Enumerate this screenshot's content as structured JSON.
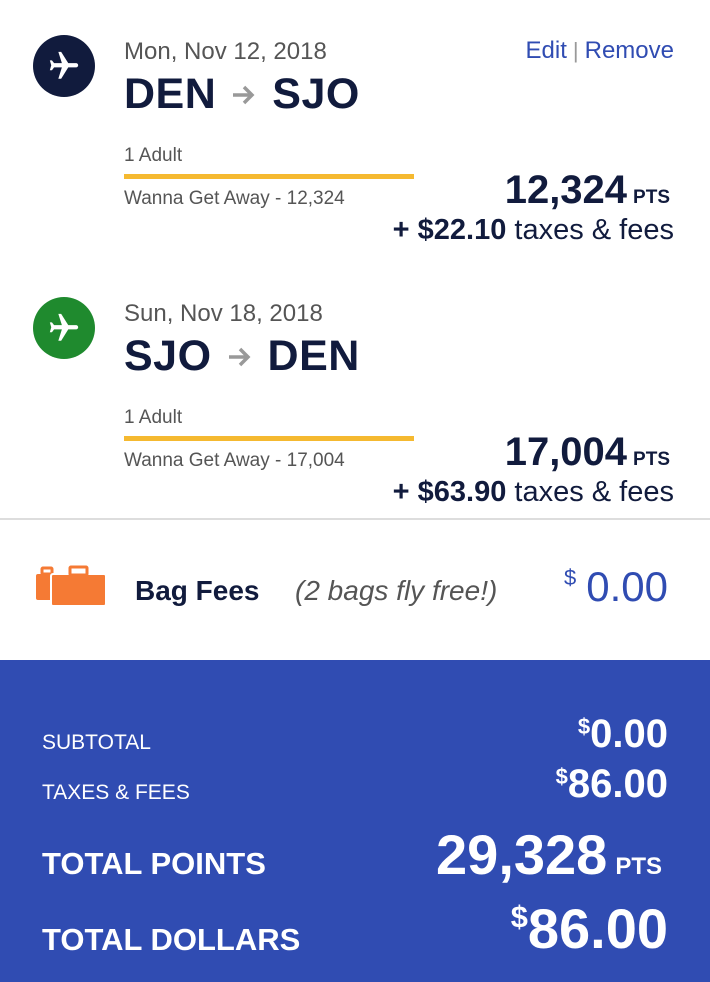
{
  "colors": {
    "navy": "#111b3d",
    "green": "#1f8a2e",
    "blue": "#304cb2",
    "gold": "#f5b930",
    "orange": "#f57a34"
  },
  "flights": [
    {
      "icon": "plane-icon",
      "date": "Mon, Nov 12, 2018",
      "from": "DEN",
      "to": "SJO",
      "passengers": "1 Adult",
      "fare": "Wanna Get Away - 12,324",
      "points": "12,324",
      "points_unit": "PTS",
      "taxes_prefix": "+ ",
      "taxes_amount": "$22.10",
      "taxes_suffix": " taxes & fees"
    },
    {
      "icon": "plane-icon",
      "date": "Sun, Nov 18, 2018",
      "from": "SJO",
      "to": "DEN",
      "passengers": "1 Adult",
      "fare": "Wanna Get Away - 17,004",
      "points": "17,004",
      "points_unit": "PTS",
      "taxes_prefix": "+ ",
      "taxes_amount": "$63.90",
      "taxes_suffix": " taxes & fees"
    }
  ],
  "actions": {
    "edit": "Edit",
    "separator": "|",
    "remove": "Remove"
  },
  "bags": {
    "icon": "luggage-icon",
    "label": "Bag Fees",
    "note": "(2 bags fly free!)",
    "currency": "$",
    "amount": "0.00"
  },
  "summary": {
    "subtotal_label": "SUBTOTAL",
    "subtotal_currency": "$",
    "subtotal_value": "0.00",
    "taxes_label": "TAXES & FEES",
    "taxes_currency": "$",
    "taxes_value": "86.00",
    "points_label": "TOTAL POINTS",
    "points_value": "29,328",
    "points_unit": "PTS",
    "dollars_label": "TOTAL DOLLARS",
    "dollars_currency": "$",
    "dollars_value": "86.00"
  }
}
